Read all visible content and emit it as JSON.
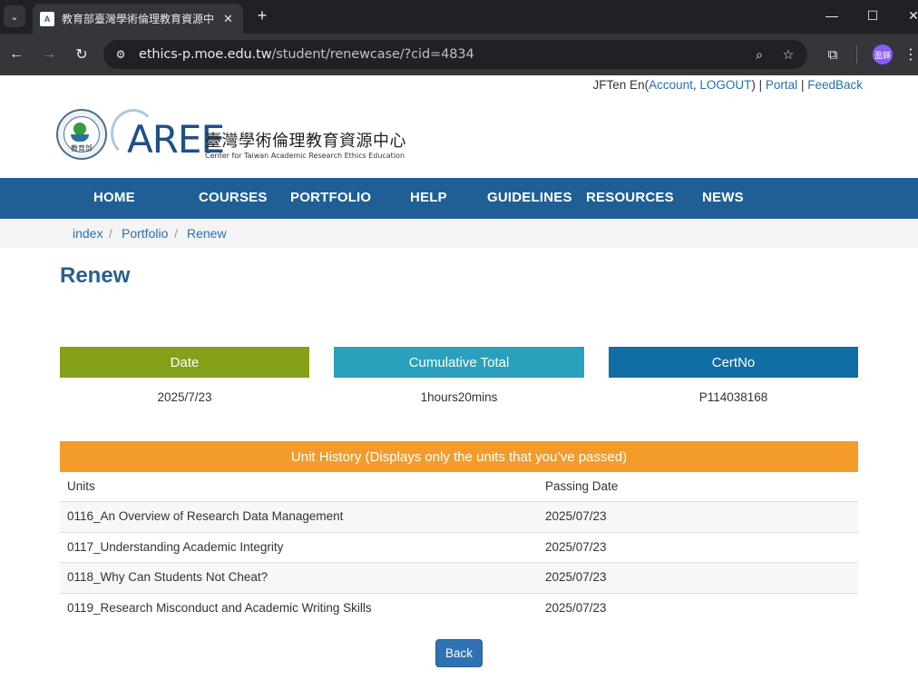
{
  "browser": {
    "tab_title": "教育部臺灣學術倫理教育資源中心",
    "tab_favicon_text": "A",
    "url_host": "ethics-p.moe.edu.tw",
    "url_path": "/student/renewcase/?cid=4834",
    "profile_initial": "盈錸"
  },
  "userbar": {
    "user": "JFTen En(",
    "account": "Account",
    "comma": ", ",
    "logout": "LOGOUT",
    "close": ")",
    "pipe1": " | ",
    "portal": "Portal",
    "pipe2": " | ",
    "feedback": "FeedBack"
  },
  "logo": {
    "seal_text": "教育部",
    "aree": "AREE",
    "center_cn": "臺灣學術倫理教育資源中心",
    "center_en": "Center for Taiwan Academic Research Ethics Education"
  },
  "nav": [
    "HOME",
    "COURSES",
    "PORTFOLIO",
    "HELP",
    "GUIDELINES",
    "RESOURCES",
    "NEWS"
  ],
  "breadcrumb": [
    "index",
    "Portfolio",
    "Renew"
  ],
  "breadcrumb_sep": "/",
  "page_title": "Renew",
  "stats": [
    {
      "label": "Date",
      "value": "2025/7/23",
      "color": "#85a019"
    },
    {
      "label": "Cumulative Total",
      "value": "1hours20mins",
      "color": "#2aa0bc"
    },
    {
      "label": "CertNo",
      "value": "P114038168",
      "color": "#0f6ea3"
    }
  ],
  "unit_history": {
    "title": "Unit History (Displays only the units that you’ve passed)",
    "color": "#f39c2b",
    "columns": [
      "Units",
      "Passing Date"
    ],
    "rows": [
      [
        "0116_An Overview of Research Data Management",
        "2025/07/23"
      ],
      [
        "0117_Understanding Academic Integrity",
        "2025/07/23"
      ],
      [
        "0118_Why Can Students Not Cheat?",
        "2025/07/23"
      ],
      [
        "0119_Research Misconduct and Academic Writing Skills",
        "2025/07/23"
      ]
    ]
  },
  "back_label": "Back"
}
